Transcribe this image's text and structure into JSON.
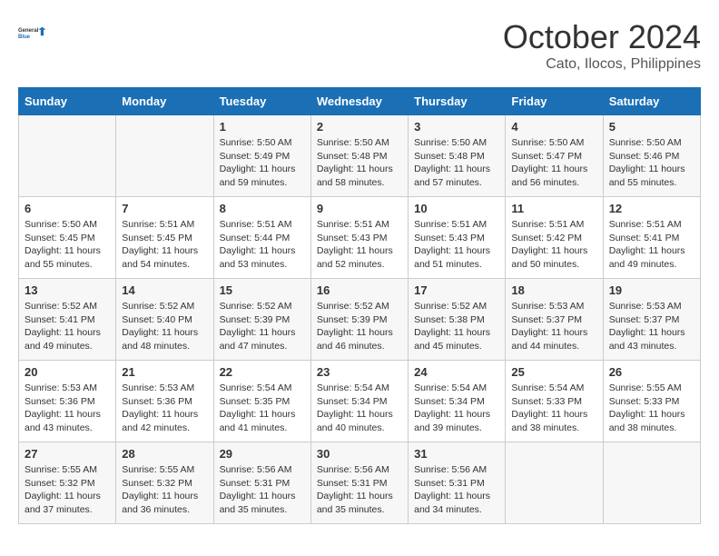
{
  "header": {
    "logo_general": "General",
    "logo_blue": "Blue",
    "month": "October 2024",
    "location": "Cato, Ilocos, Philippines"
  },
  "columns": [
    "Sunday",
    "Monday",
    "Tuesday",
    "Wednesday",
    "Thursday",
    "Friday",
    "Saturday"
  ],
  "weeks": [
    [
      {
        "day": "",
        "content": ""
      },
      {
        "day": "",
        "content": ""
      },
      {
        "day": "1",
        "content": "Sunrise: 5:50 AM\nSunset: 5:49 PM\nDaylight: 11 hours and 59 minutes."
      },
      {
        "day": "2",
        "content": "Sunrise: 5:50 AM\nSunset: 5:48 PM\nDaylight: 11 hours and 58 minutes."
      },
      {
        "day": "3",
        "content": "Sunrise: 5:50 AM\nSunset: 5:48 PM\nDaylight: 11 hours and 57 minutes."
      },
      {
        "day": "4",
        "content": "Sunrise: 5:50 AM\nSunset: 5:47 PM\nDaylight: 11 hours and 56 minutes."
      },
      {
        "day": "5",
        "content": "Sunrise: 5:50 AM\nSunset: 5:46 PM\nDaylight: 11 hours and 55 minutes."
      }
    ],
    [
      {
        "day": "6",
        "content": "Sunrise: 5:50 AM\nSunset: 5:45 PM\nDaylight: 11 hours and 55 minutes."
      },
      {
        "day": "7",
        "content": "Sunrise: 5:51 AM\nSunset: 5:45 PM\nDaylight: 11 hours and 54 minutes."
      },
      {
        "day": "8",
        "content": "Sunrise: 5:51 AM\nSunset: 5:44 PM\nDaylight: 11 hours and 53 minutes."
      },
      {
        "day": "9",
        "content": "Sunrise: 5:51 AM\nSunset: 5:43 PM\nDaylight: 11 hours and 52 minutes."
      },
      {
        "day": "10",
        "content": "Sunrise: 5:51 AM\nSunset: 5:43 PM\nDaylight: 11 hours and 51 minutes."
      },
      {
        "day": "11",
        "content": "Sunrise: 5:51 AM\nSunset: 5:42 PM\nDaylight: 11 hours and 50 minutes."
      },
      {
        "day": "12",
        "content": "Sunrise: 5:51 AM\nSunset: 5:41 PM\nDaylight: 11 hours and 49 minutes."
      }
    ],
    [
      {
        "day": "13",
        "content": "Sunrise: 5:52 AM\nSunset: 5:41 PM\nDaylight: 11 hours and 49 minutes."
      },
      {
        "day": "14",
        "content": "Sunrise: 5:52 AM\nSunset: 5:40 PM\nDaylight: 11 hours and 48 minutes."
      },
      {
        "day": "15",
        "content": "Sunrise: 5:52 AM\nSunset: 5:39 PM\nDaylight: 11 hours and 47 minutes."
      },
      {
        "day": "16",
        "content": "Sunrise: 5:52 AM\nSunset: 5:39 PM\nDaylight: 11 hours and 46 minutes."
      },
      {
        "day": "17",
        "content": "Sunrise: 5:52 AM\nSunset: 5:38 PM\nDaylight: 11 hours and 45 minutes."
      },
      {
        "day": "18",
        "content": "Sunrise: 5:53 AM\nSunset: 5:37 PM\nDaylight: 11 hours and 44 minutes."
      },
      {
        "day": "19",
        "content": "Sunrise: 5:53 AM\nSunset: 5:37 PM\nDaylight: 11 hours and 43 minutes."
      }
    ],
    [
      {
        "day": "20",
        "content": "Sunrise: 5:53 AM\nSunset: 5:36 PM\nDaylight: 11 hours and 43 minutes."
      },
      {
        "day": "21",
        "content": "Sunrise: 5:53 AM\nSunset: 5:36 PM\nDaylight: 11 hours and 42 minutes."
      },
      {
        "day": "22",
        "content": "Sunrise: 5:54 AM\nSunset: 5:35 PM\nDaylight: 11 hours and 41 minutes."
      },
      {
        "day": "23",
        "content": "Sunrise: 5:54 AM\nSunset: 5:34 PM\nDaylight: 11 hours and 40 minutes."
      },
      {
        "day": "24",
        "content": "Sunrise: 5:54 AM\nSunset: 5:34 PM\nDaylight: 11 hours and 39 minutes."
      },
      {
        "day": "25",
        "content": "Sunrise: 5:54 AM\nSunset: 5:33 PM\nDaylight: 11 hours and 38 minutes."
      },
      {
        "day": "26",
        "content": "Sunrise: 5:55 AM\nSunset: 5:33 PM\nDaylight: 11 hours and 38 minutes."
      }
    ],
    [
      {
        "day": "27",
        "content": "Sunrise: 5:55 AM\nSunset: 5:32 PM\nDaylight: 11 hours and 37 minutes."
      },
      {
        "day": "28",
        "content": "Sunrise: 5:55 AM\nSunset: 5:32 PM\nDaylight: 11 hours and 36 minutes."
      },
      {
        "day": "29",
        "content": "Sunrise: 5:56 AM\nSunset: 5:31 PM\nDaylight: 11 hours and 35 minutes."
      },
      {
        "day": "30",
        "content": "Sunrise: 5:56 AM\nSunset: 5:31 PM\nDaylight: 11 hours and 35 minutes."
      },
      {
        "day": "31",
        "content": "Sunrise: 5:56 AM\nSunset: 5:31 PM\nDaylight: 11 hours and 34 minutes."
      },
      {
        "day": "",
        "content": ""
      },
      {
        "day": "",
        "content": ""
      }
    ]
  ]
}
